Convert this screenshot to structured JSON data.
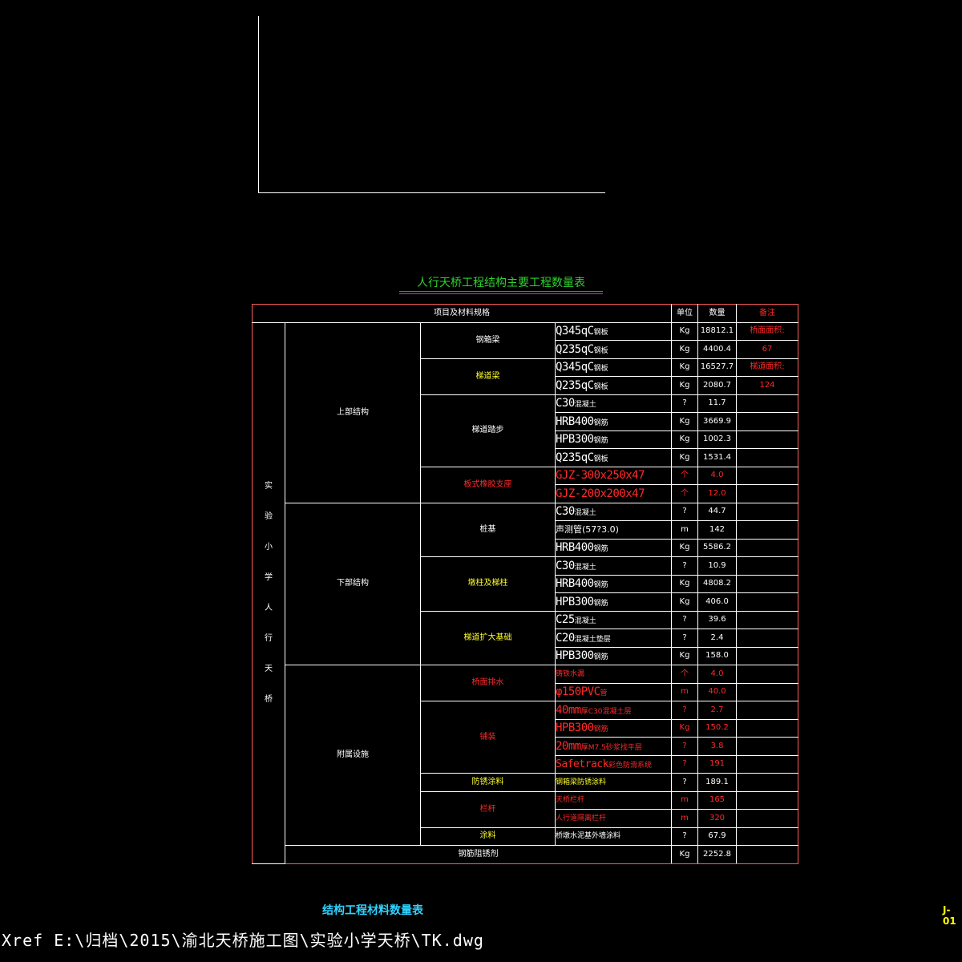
{
  "title": "人行天桥工程结构主要工程数量表",
  "header": {
    "item": "项目及材料规格",
    "unit": "单位",
    "qty": "数量",
    "remark": "备注"
  },
  "vertical_label": [
    "实",
    "验",
    "小",
    "学",
    "人",
    "行",
    "天",
    "桥"
  ],
  "groups": {
    "upper": "上部结构",
    "lower": "下部结构",
    "aux": "附属设施"
  },
  "subs": {
    "s1": "钢箱梁",
    "s2": "梯道梁",
    "s3": "梯道踏步",
    "s4": "板式橡胶支座",
    "s5": "桩基",
    "s6": "墩柱及梯柱",
    "s7": "梯道扩大基础",
    "s8": "桥面排水",
    "s9": "铺装",
    "s10": "防锈涂料",
    "s11": "栏杆",
    "s12": "涂料",
    "s13": "钢筋阻锈剂"
  },
  "rows": [
    {
      "mat_code": "Q345qC",
      "mat_cn": "钢板",
      "unit": "Kg",
      "qty": "18812.1",
      "remark": "桥面面积:"
    },
    {
      "mat_code": "Q235qC",
      "mat_cn": "钢板",
      "unit": "Kg",
      "qty": "4400.4",
      "remark": "67"
    },
    {
      "mat_code": "Q345qC",
      "mat_cn": "钢板",
      "unit": "Kg",
      "qty": "16527.7",
      "remark": "梯道面积:"
    },
    {
      "mat_code": "Q235qC",
      "mat_cn": "钢板",
      "unit": "Kg",
      "qty": "2080.7",
      "remark": "124"
    },
    {
      "mat_code": "C30",
      "mat_cn": "混凝土",
      "unit": "?",
      "qty": "11.7",
      "remark": ""
    },
    {
      "mat_code": "HRB400",
      "mat_cn": "钢筋",
      "unit": "Kg",
      "qty": "3669.9",
      "remark": ""
    },
    {
      "mat_code": "HPB300",
      "mat_cn": "钢筋",
      "unit": "Kg",
      "qty": "1002.3",
      "remark": ""
    },
    {
      "mat_code": "Q235qC",
      "mat_cn": "钢板",
      "unit": "Kg",
      "qty": "1531.4",
      "remark": ""
    },
    {
      "mat_code": "GJZ-300x250x47",
      "mat_cn": "",
      "unit": "个",
      "qty": "4.0",
      "remark": ""
    },
    {
      "mat_code": "GJZ-200x200x47",
      "mat_cn": "",
      "unit": "个",
      "qty": "12.0",
      "remark": ""
    },
    {
      "mat_code": "C30",
      "mat_cn": "混凝土",
      "unit": "?",
      "qty": "44.7",
      "remark": ""
    },
    {
      "mat_code": "",
      "mat_cn": "声测管(57?3.0)",
      "unit": "m",
      "qty": "142",
      "remark": ""
    },
    {
      "mat_code": "HRB400",
      "mat_cn": "钢筋",
      "unit": "Kg",
      "qty": "5586.2",
      "remark": ""
    },
    {
      "mat_code": "C30",
      "mat_cn": "混凝土",
      "unit": "?",
      "qty": "10.9",
      "remark": ""
    },
    {
      "mat_code": "HRB400",
      "mat_cn": "钢筋",
      "unit": "Kg",
      "qty": "4808.2",
      "remark": ""
    },
    {
      "mat_code": "HPB300",
      "mat_cn": "钢筋",
      "unit": "Kg",
      "qty": "406.0",
      "remark": ""
    },
    {
      "mat_code": "C25",
      "mat_cn": "混凝土",
      "unit": "?",
      "qty": "39.6",
      "remark": ""
    },
    {
      "mat_code": "C20",
      "mat_cn": "混凝土垫层",
      "unit": "?",
      "qty": "2.4",
      "remark": ""
    },
    {
      "mat_code": "HPB300",
      "mat_cn": "钢筋",
      "unit": "Kg",
      "qty": "158.0",
      "remark": ""
    },
    {
      "mat_code": "",
      "mat_cn": "铸铁水漏",
      "unit": "个",
      "qty": "4.0",
      "remark": ""
    },
    {
      "mat_code": "φ150PVC",
      "mat_cn": "管",
      "unit": "m",
      "qty": "40.0",
      "remark": ""
    },
    {
      "mat_code": "40mm",
      "mat_cn": "厚C30混凝土层",
      "unit": "?",
      "qty": "2.7",
      "remark": ""
    },
    {
      "mat_code": "HPB300",
      "mat_cn": "钢筋",
      "unit": "Kg",
      "qty": "150.2",
      "remark": ""
    },
    {
      "mat_code": "20mm",
      "mat_cn": "厚M7.5砂浆找平层",
      "unit": "?",
      "qty": "3.8",
      "remark": ""
    },
    {
      "mat_code": "Safetrack",
      "mat_cn": "彩色防滑系统",
      "unit": "?",
      "qty": "191",
      "remark": ""
    },
    {
      "mat_code": "",
      "mat_cn": "钢箱梁防锈涂料",
      "unit": "?",
      "qty": "189.1",
      "remark": ""
    },
    {
      "mat_code": "",
      "mat_cn": "天桥栏杆",
      "unit": "m",
      "qty": "165",
      "remark": ""
    },
    {
      "mat_code": "",
      "mat_cn": "人行道隔离栏杆",
      "unit": "m",
      "qty": "320",
      "remark": ""
    },
    {
      "mat_code": "",
      "mat_cn": "桥墩水泥基外墙涂料",
      "unit": "?",
      "qty": "67.9",
      "remark": ""
    },
    {
      "mat_code": "",
      "mat_cn": "",
      "unit": "Kg",
      "qty": "2252.8",
      "remark": ""
    }
  ],
  "bottom_title": "结构工程材料数量表",
  "sheet_no": "J-01",
  "xref": "Xref E:\\归档\\2015\\渝北天桥施工图\\实验小学天桥\\TK.dwg",
  "colors": {
    "background": "#000000",
    "grid": "#ffffff",
    "frame": "#ff5a5a",
    "red_text": "#ff2a2a",
    "yellow_text": "#ffff2a",
    "title_green": "#2fd12f",
    "bottom_title_cyan": "#2fd2ff"
  }
}
